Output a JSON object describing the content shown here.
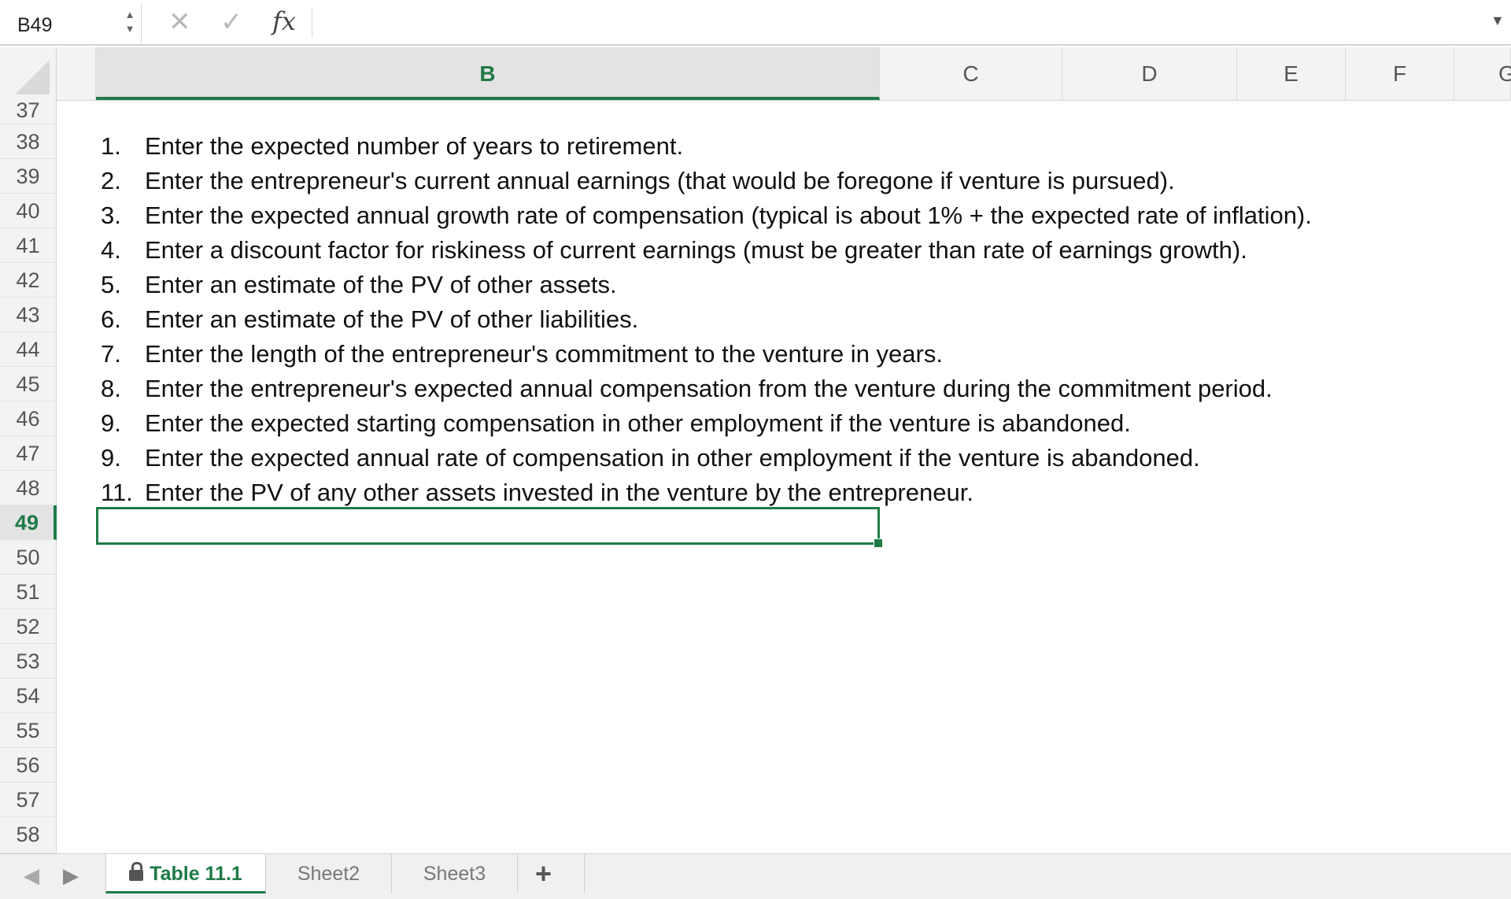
{
  "formula_bar": {
    "name_box": "B49",
    "stepper_icon": "stepper-icon",
    "cancel_glyph": "✕",
    "confirm_glyph": "✓",
    "fx_label": "fx",
    "formula_value": "",
    "dropdown_glyph": "▼"
  },
  "columns": {
    "B": "B",
    "C": "C",
    "D": "D",
    "E": "E",
    "F": "F",
    "G": "G"
  },
  "rows": [
    "37",
    "38",
    "39",
    "40",
    "41",
    "42",
    "43",
    "44",
    "45",
    "46",
    "47",
    "48",
    "49",
    "50",
    "51",
    "52",
    "53",
    "54",
    "55",
    "56",
    "57",
    "58"
  ],
  "active_cell": {
    "column": "B",
    "row": "49"
  },
  "instructions": [
    {
      "num": "1.",
      "text": "Enter the expected number of years to retirement."
    },
    {
      "num": "2.",
      "text": "Enter the entrepreneur's current annual earnings (that would be foregone if venture is pursued)."
    },
    {
      "num": "3.",
      "text": "Enter the expected annual growth rate of compensation (typical is about 1% + the expected rate of inflation)."
    },
    {
      "num": "4.",
      "text": "Enter a discount factor for riskiness of current earnings (must be greater than rate of earnings growth)."
    },
    {
      "num": "5.",
      "text": "Enter an estimate of the PV of other assets."
    },
    {
      "num": "6.",
      "text": "Enter an estimate of the PV of other liabilities."
    },
    {
      "num": "7.",
      "text": "Enter the length of the entrepreneur's commitment to the venture in years."
    },
    {
      "num": "8.",
      "text": "Enter the entrepreneur's expected annual compensation from the venture during the commitment period."
    },
    {
      "num": "9.",
      "text": "Enter the expected starting compensation in other employment if the venture is abandoned."
    },
    {
      "num": "9.",
      "text": "Enter the expected annual rate of compensation in other employment if the venture is abandoned."
    },
    {
      "num": "11.",
      "text": "Enter the PV of any other assets invested in the venture by the entrepreneur."
    }
  ],
  "sheet_tabs": {
    "prev_glyph": "◀",
    "next_glyph": "▶",
    "tabs": [
      "Table 11.1",
      "Sheet2",
      "Sheet3"
    ],
    "active": "Table 11.1",
    "add_glyph": "+"
  },
  "colors": {
    "accent": "#1e7b46"
  }
}
